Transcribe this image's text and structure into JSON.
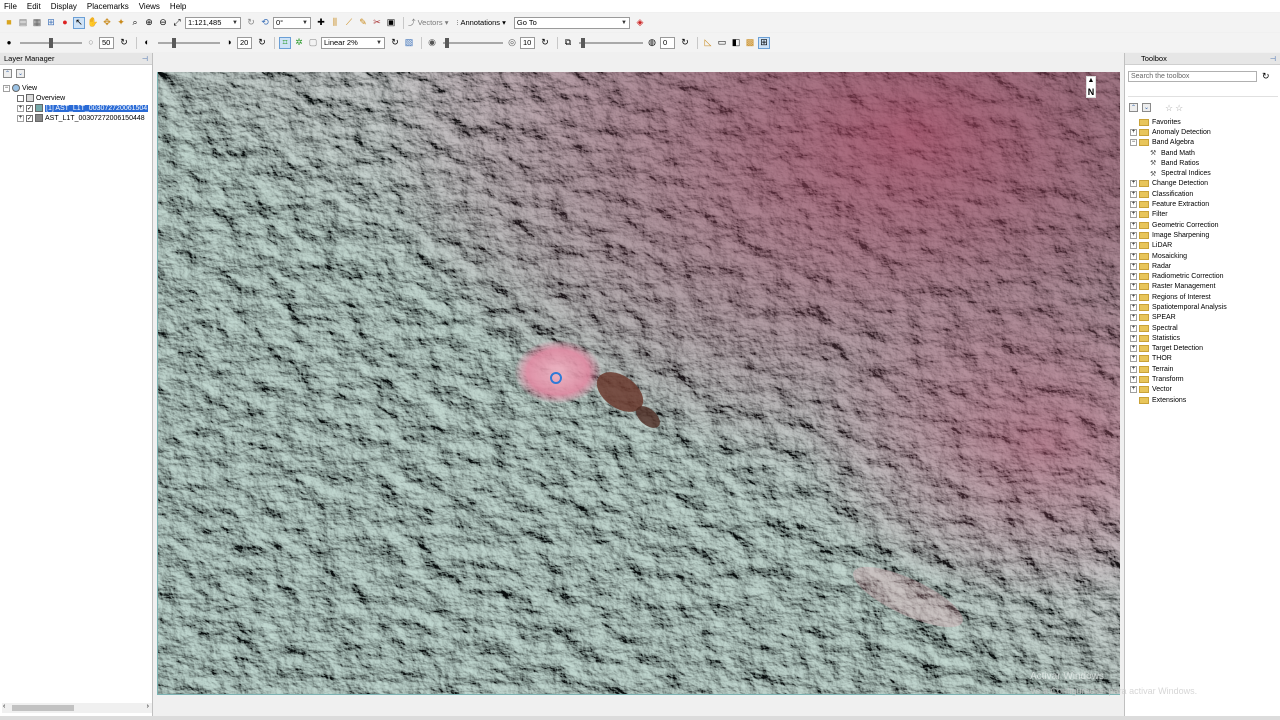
{
  "menu": [
    "File",
    "Edit",
    "Display",
    "Placemarks",
    "Views",
    "Help"
  ],
  "toolbar1": {
    "scale": "1:121,485",
    "rotation": "0°",
    "vectors_label": "Vectors",
    "annotations_label": "Annotations",
    "goto_value": "Go To"
  },
  "toolbar2": {
    "brightness": "50",
    "contrast": "20",
    "stretch": "Linear 2%",
    "sharpen": "10",
    "transparency": "0"
  },
  "layer_manager": {
    "title": "Layer Manager",
    "root": "View",
    "overview": "Overview",
    "layers": [
      {
        "label": "[1] AST_L1T_003072720061504",
        "selected": true
      },
      {
        "label": "AST_L1T_00307272006150448",
        "selected": false
      }
    ]
  },
  "toolbox": {
    "title": "Toolbox",
    "search_placeholder": "Search the toolbox",
    "items": [
      {
        "label": "Favorites",
        "type": "folder",
        "expand": ""
      },
      {
        "label": "Anomaly Detection",
        "type": "folder",
        "expand": "+"
      },
      {
        "label": "Band Algebra",
        "type": "folder",
        "expand": "−"
      },
      {
        "label": "Band Math",
        "type": "tool",
        "expand": ""
      },
      {
        "label": "Band Ratios",
        "type": "tool",
        "expand": ""
      },
      {
        "label": "Spectral Indices",
        "type": "tool",
        "expand": ""
      },
      {
        "label": "Change Detection",
        "type": "folder",
        "expand": "+"
      },
      {
        "label": "Classification",
        "type": "folder",
        "expand": "+"
      },
      {
        "label": "Feature Extraction",
        "type": "folder",
        "expand": "+"
      },
      {
        "label": "Filter",
        "type": "folder",
        "expand": "+"
      },
      {
        "label": "Geometric Correction",
        "type": "folder",
        "expand": "+"
      },
      {
        "label": "Image Sharpening",
        "type": "folder",
        "expand": "+"
      },
      {
        "label": "LiDAR",
        "type": "folder",
        "expand": "+"
      },
      {
        "label": "Mosaicking",
        "type": "folder",
        "expand": "+"
      },
      {
        "label": "Radar",
        "type": "folder",
        "expand": "+"
      },
      {
        "label": "Radiometric Correction",
        "type": "folder",
        "expand": "+"
      },
      {
        "label": "Raster Management",
        "type": "folder",
        "expand": "+"
      },
      {
        "label": "Regions of Interest",
        "type": "folder",
        "expand": "+"
      },
      {
        "label": "Spatiotemporal Analysis",
        "type": "folder",
        "expand": "+"
      },
      {
        "label": "SPEAR",
        "type": "folder",
        "expand": "+"
      },
      {
        "label": "Spectral",
        "type": "folder",
        "expand": "+"
      },
      {
        "label": "Statistics",
        "type": "folder",
        "expand": "+"
      },
      {
        "label": "Target Detection",
        "type": "folder",
        "expand": "+"
      },
      {
        "label": "THOR",
        "type": "folder",
        "expand": "+"
      },
      {
        "label": "Terrain",
        "type": "folder",
        "expand": "+"
      },
      {
        "label": "Transform",
        "type": "folder",
        "expand": "+"
      },
      {
        "label": "Vector",
        "type": "folder",
        "expand": "+"
      },
      {
        "label": "Extensions",
        "type": "folder",
        "expand": ""
      }
    ]
  },
  "map": {
    "north_label": "N"
  },
  "watermark": {
    "line1": "Activar Windows",
    "line2": "Ve a Configuración para activar Windows."
  },
  "colors": {
    "selection": "#2a6bd6",
    "folder": "#e8c55a",
    "map_teal": "#8fa9a0",
    "map_red": "#8a3a52"
  }
}
